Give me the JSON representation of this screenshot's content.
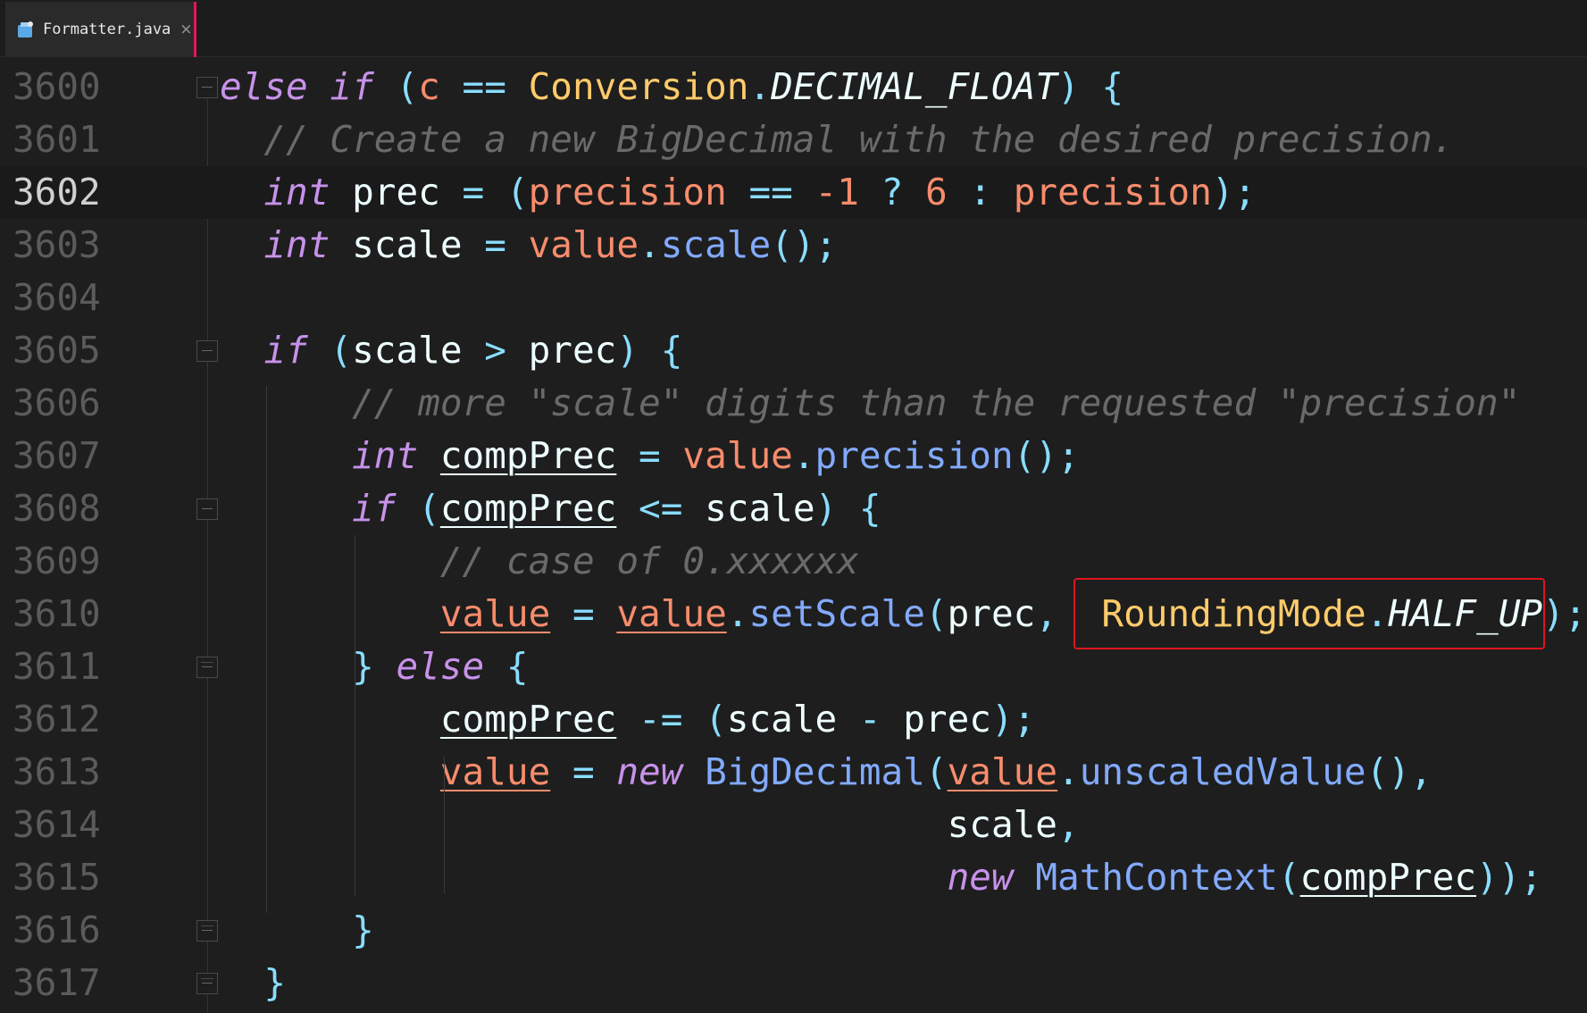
{
  "tab": {
    "label": "Formatter.java",
    "close_glyph": "×",
    "icon": "java-file-icon"
  },
  "editor": {
    "current_line": "3602",
    "lines": [
      {
        "n": "3600",
        "t": [
          [
            "kw",
            "else if"
          ],
          [
            "id",
            " "
          ],
          [
            "op",
            "("
          ],
          [
            "var",
            "c"
          ],
          [
            "id",
            " "
          ],
          [
            "op",
            "=="
          ],
          [
            "id",
            " "
          ],
          [
            "cls",
            "Conversion"
          ],
          [
            "op",
            "."
          ],
          [
            "cnst",
            "DECIMAL_FLOAT"
          ],
          [
            "op",
            ")"
          ],
          [
            "id",
            " "
          ],
          [
            "op",
            "{"
          ]
        ]
      },
      {
        "n": "3601",
        "t": [
          [
            "cmt",
            "  // Create a new BigDecimal with the desired precision."
          ]
        ]
      },
      {
        "n": "3602",
        "t": [
          [
            "id",
            "  "
          ],
          [
            "kw",
            "int"
          ],
          [
            "id",
            " prec "
          ],
          [
            "op",
            "="
          ],
          [
            "id",
            " "
          ],
          [
            "op",
            "("
          ],
          [
            "var",
            "precision"
          ],
          [
            "id",
            " "
          ],
          [
            "op",
            "=="
          ],
          [
            "id",
            " "
          ],
          [
            "num",
            "-1"
          ],
          [
            "id",
            " "
          ],
          [
            "op",
            "?"
          ],
          [
            "id",
            " "
          ],
          [
            "num",
            "6"
          ],
          [
            "id",
            " "
          ],
          [
            "op",
            ":"
          ],
          [
            "id",
            " "
          ],
          [
            "var",
            "precision"
          ],
          [
            "op",
            ");"
          ]
        ]
      },
      {
        "n": "3603",
        "t": [
          [
            "id",
            "  "
          ],
          [
            "kw",
            "int"
          ],
          [
            "id",
            " scale "
          ],
          [
            "op",
            "="
          ],
          [
            "id",
            " "
          ],
          [
            "var",
            "value"
          ],
          [
            "op",
            "."
          ],
          [
            "fn",
            "scale"
          ],
          [
            "op",
            "();"
          ]
        ]
      },
      {
        "n": "3604",
        "t": []
      },
      {
        "n": "3605",
        "t": [
          [
            "id",
            "  "
          ],
          [
            "kw",
            "if"
          ],
          [
            "id",
            " "
          ],
          [
            "op",
            "("
          ],
          [
            "id",
            "scale "
          ],
          [
            "op",
            ">"
          ],
          [
            "id",
            " prec"
          ],
          [
            "op",
            ")"
          ],
          [
            "id",
            " "
          ],
          [
            "op",
            "{"
          ]
        ]
      },
      {
        "n": "3606",
        "t": [
          [
            "cmt",
            "      // more \"scale\" digits than the requested \"precision\""
          ]
        ]
      },
      {
        "n": "3607",
        "t": [
          [
            "id",
            "      "
          ],
          [
            "kw",
            "int"
          ],
          [
            "id",
            " "
          ],
          [
            "id ul",
            "compPrec"
          ],
          [
            "id",
            " "
          ],
          [
            "op",
            "="
          ],
          [
            "id",
            " "
          ],
          [
            "var",
            "value"
          ],
          [
            "op",
            "."
          ],
          [
            "fn",
            "precision"
          ],
          [
            "op",
            "();"
          ]
        ]
      },
      {
        "n": "3608",
        "t": [
          [
            "id",
            "      "
          ],
          [
            "kw",
            "if"
          ],
          [
            "id",
            " "
          ],
          [
            "op",
            "("
          ],
          [
            "id ul",
            "compPrec"
          ],
          [
            "id",
            " "
          ],
          [
            "op",
            "<="
          ],
          [
            "id",
            " scale"
          ],
          [
            "op",
            ")"
          ],
          [
            "id",
            " "
          ],
          [
            "op",
            "{"
          ]
        ]
      },
      {
        "n": "3609",
        "t": [
          [
            "cmt",
            "          // case of 0.xxxxxx"
          ]
        ]
      },
      {
        "n": "3610",
        "t": [
          [
            "id",
            "          "
          ],
          [
            "var ul",
            "value"
          ],
          [
            "id",
            " "
          ],
          [
            "op",
            "="
          ],
          [
            "id",
            " "
          ],
          [
            "var ul",
            "value"
          ],
          [
            "op",
            "."
          ],
          [
            "fn",
            "setScale"
          ],
          [
            "op",
            "("
          ],
          [
            "id",
            "prec"
          ],
          [
            "op",
            ","
          ],
          [
            "id",
            "  "
          ],
          [
            "cls",
            "RoundingMode"
          ],
          [
            "op",
            "."
          ],
          [
            "cnst",
            "HALF_UP"
          ],
          [
            "op",
            ");"
          ]
        ]
      },
      {
        "n": "3611",
        "t": [
          [
            "id",
            "      "
          ],
          [
            "op",
            "}"
          ],
          [
            "id",
            " "
          ],
          [
            "kw",
            "else"
          ],
          [
            "id",
            " "
          ],
          [
            "op",
            "{"
          ]
        ]
      },
      {
        "n": "3612",
        "t": [
          [
            "id",
            "          "
          ],
          [
            "id ul",
            "compPrec"
          ],
          [
            "id",
            " "
          ],
          [
            "op",
            "-="
          ],
          [
            "id",
            " "
          ],
          [
            "op",
            "("
          ],
          [
            "id",
            "scale "
          ],
          [
            "op",
            "-"
          ],
          [
            "id",
            " prec"
          ],
          [
            "op",
            ");"
          ]
        ]
      },
      {
        "n": "3613",
        "t": [
          [
            "id",
            "          "
          ],
          [
            "var ul",
            "value"
          ],
          [
            "id",
            " "
          ],
          [
            "op",
            "="
          ],
          [
            "id",
            " "
          ],
          [
            "kw",
            "new"
          ],
          [
            "id",
            " "
          ],
          [
            "fn",
            "BigDecimal"
          ],
          [
            "op",
            "("
          ],
          [
            "var ul",
            "value"
          ],
          [
            "op",
            "."
          ],
          [
            "fn",
            "unscaledValue"
          ],
          [
            "op",
            "(),"
          ]
        ]
      },
      {
        "n": "3614",
        "t": [
          [
            "id",
            "                                 scale"
          ],
          [
            "op",
            ","
          ]
        ]
      },
      {
        "n": "3615",
        "t": [
          [
            "id",
            "                                 "
          ],
          [
            "kw",
            "new"
          ],
          [
            "id",
            " "
          ],
          [
            "fn",
            "MathContext"
          ],
          [
            "op",
            "("
          ],
          [
            "id ul",
            "compPrec"
          ],
          [
            "op",
            "));"
          ]
        ]
      },
      {
        "n": "3616",
        "t": [
          [
            "id",
            "      "
          ],
          [
            "op",
            "}"
          ]
        ]
      },
      {
        "n": "3617",
        "t": [
          [
            "id",
            "  "
          ],
          [
            "op",
            "}"
          ]
        ]
      }
    ]
  },
  "folds": [
    "3600",
    "3605",
    "3608",
    "3611",
    "3616",
    "3617"
  ],
  "highlight": {
    "line": "3610",
    "text": "RoundingMode.HALF_UP",
    "color": "#e0141e"
  }
}
